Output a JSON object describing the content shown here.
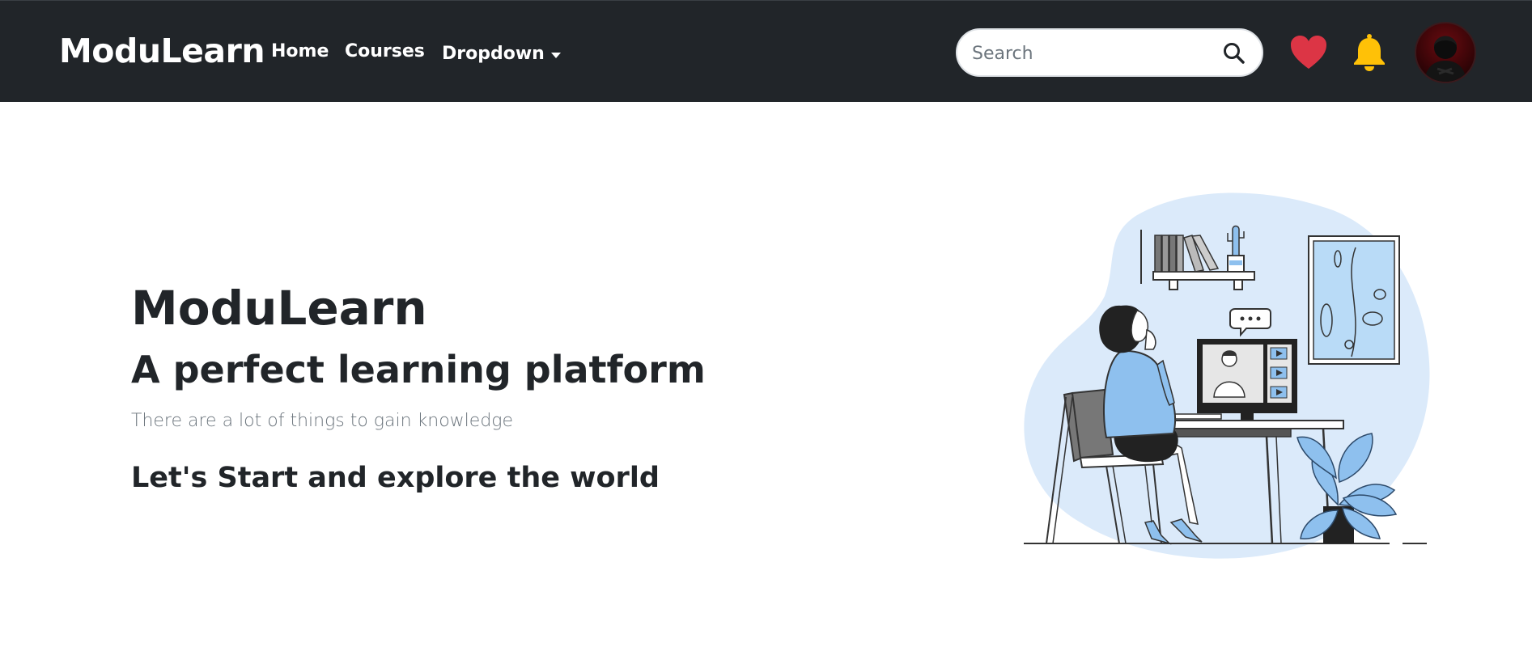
{
  "navbar": {
    "brand": "ModuLearn",
    "links": [
      {
        "label": "Home"
      },
      {
        "label": "Courses"
      },
      {
        "label": "Dropdown"
      }
    ],
    "search": {
      "placeholder": "Search",
      "value": ""
    },
    "icons": {
      "search": "search-icon",
      "favorites": "heart-icon",
      "notifications": "bell-icon",
      "profile": "avatar"
    }
  },
  "hero": {
    "title": "ModuLearn",
    "subtitle": "A perfect learning platform",
    "lead": "There are a lot of things to gain knowledge",
    "cta": "Let's Start and explore the world",
    "illustration": "woman-studying-online-illustration"
  },
  "colors": {
    "navbar_bg": "#212529",
    "heart": "#dc3545",
    "bell": "#ffc107",
    "illustration_blob": "#dbeafa",
    "illustration_accent": "#8ec0ee"
  }
}
